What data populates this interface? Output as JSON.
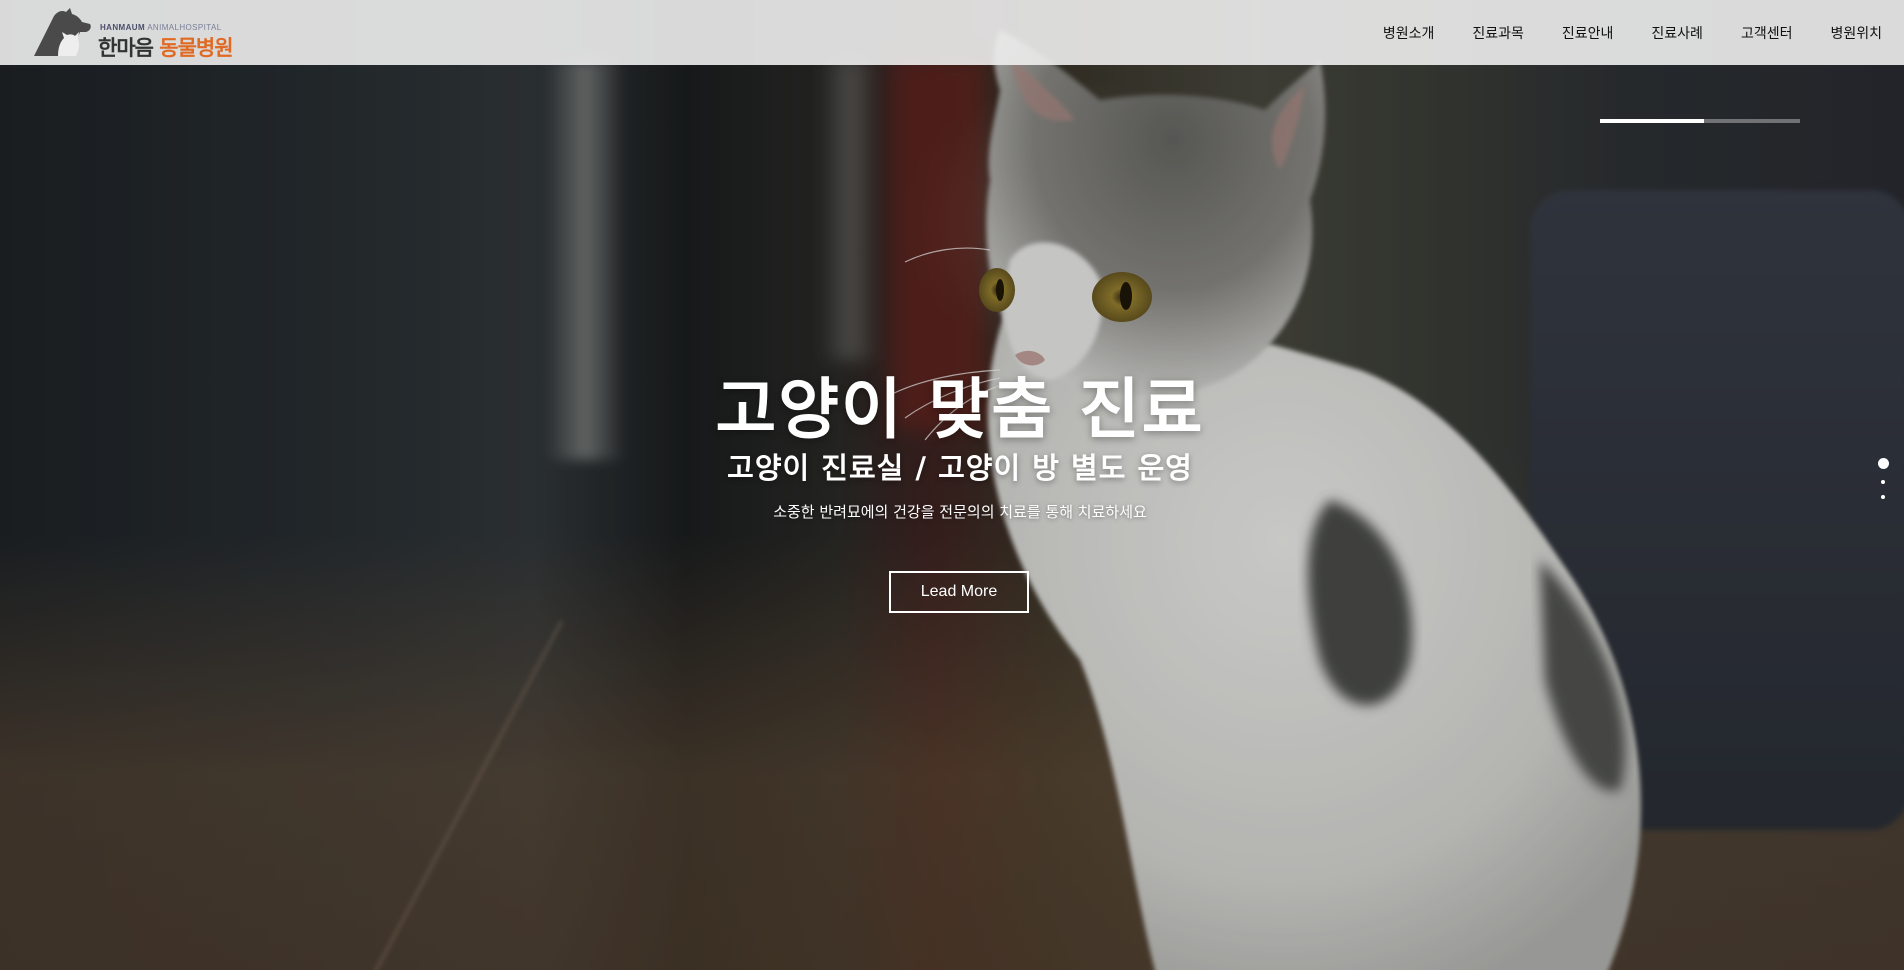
{
  "header": {
    "logo": {
      "sub_en_bold": "HANMAUM",
      "sub_en_light": " ANIMALHOSPITAL",
      "title_part1": "한마음",
      "title_part2": " 동물병원"
    },
    "nav": [
      {
        "label": "병원소개"
      },
      {
        "label": "진료과목"
      },
      {
        "label": "진료안내"
      },
      {
        "label": "진료사례"
      },
      {
        "label": "고객센터"
      },
      {
        "label": "병원위치"
      }
    ]
  },
  "hero": {
    "title": "고양이 맞춤 진료",
    "subtitle": "고양이 진료실 / 고양이 방 별도 운영",
    "description": "소중한 반려묘에의 건강을 전문의의 치료를 통해 치료하세요",
    "button_label": "Lead More",
    "slide_progress": 0.52,
    "pager": {
      "total": 3,
      "active_index": 0
    }
  },
  "colors": {
    "brand_orange": "#e06a24",
    "header_bg": "#eeeeee",
    "hero_text": "#ffffff"
  },
  "icons": [
    "dog-cat-silhouette-logo-icon"
  ]
}
